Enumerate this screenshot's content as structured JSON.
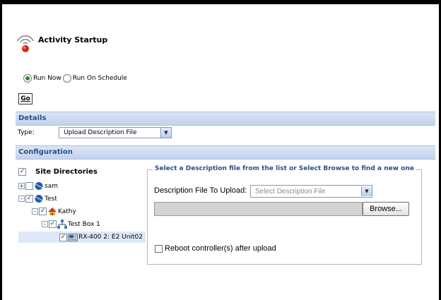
{
  "header": {
    "title": "Activity Startup"
  },
  "run_options": {
    "selected": "run_now",
    "items": [
      {
        "id": "run_now",
        "label": "Run Now"
      },
      {
        "id": "run_on_schedule",
        "label": "Run On Schedule"
      }
    ]
  },
  "go_label": "Go",
  "details": {
    "section_title": "Details",
    "type_label": "Type:",
    "type_value": "Upload Description File"
  },
  "configuration": {
    "section_title": "Configuration",
    "tree": {
      "root_label": "Site Directories",
      "nodes": [
        {
          "label": "sam",
          "expanded": false,
          "checked": false,
          "icon": "site-folder-icon"
        },
        {
          "label": "Test",
          "expanded": true,
          "checked": true,
          "icon": "site-folder-icon"
        },
        {
          "label": "Kathy",
          "expanded": true,
          "checked": true,
          "icon": "house-icon"
        },
        {
          "label": "Test Box 1",
          "expanded": true,
          "checked": true,
          "icon": "network-icon"
        },
        {
          "label": "RX-400 2: E2 Unit02",
          "checked": true,
          "icon": "controller-icon",
          "selected": true
        }
      ]
    },
    "upload": {
      "legend": "Select a Description file from the list or Select Browse to find a new one",
      "desc_label": "Description File To Upload:",
      "desc_placeholder": "Select Description File",
      "browse_label": "Browse...",
      "reboot_label": "Reboot controller(s) after upload",
      "reboot_checked": false
    }
  }
}
